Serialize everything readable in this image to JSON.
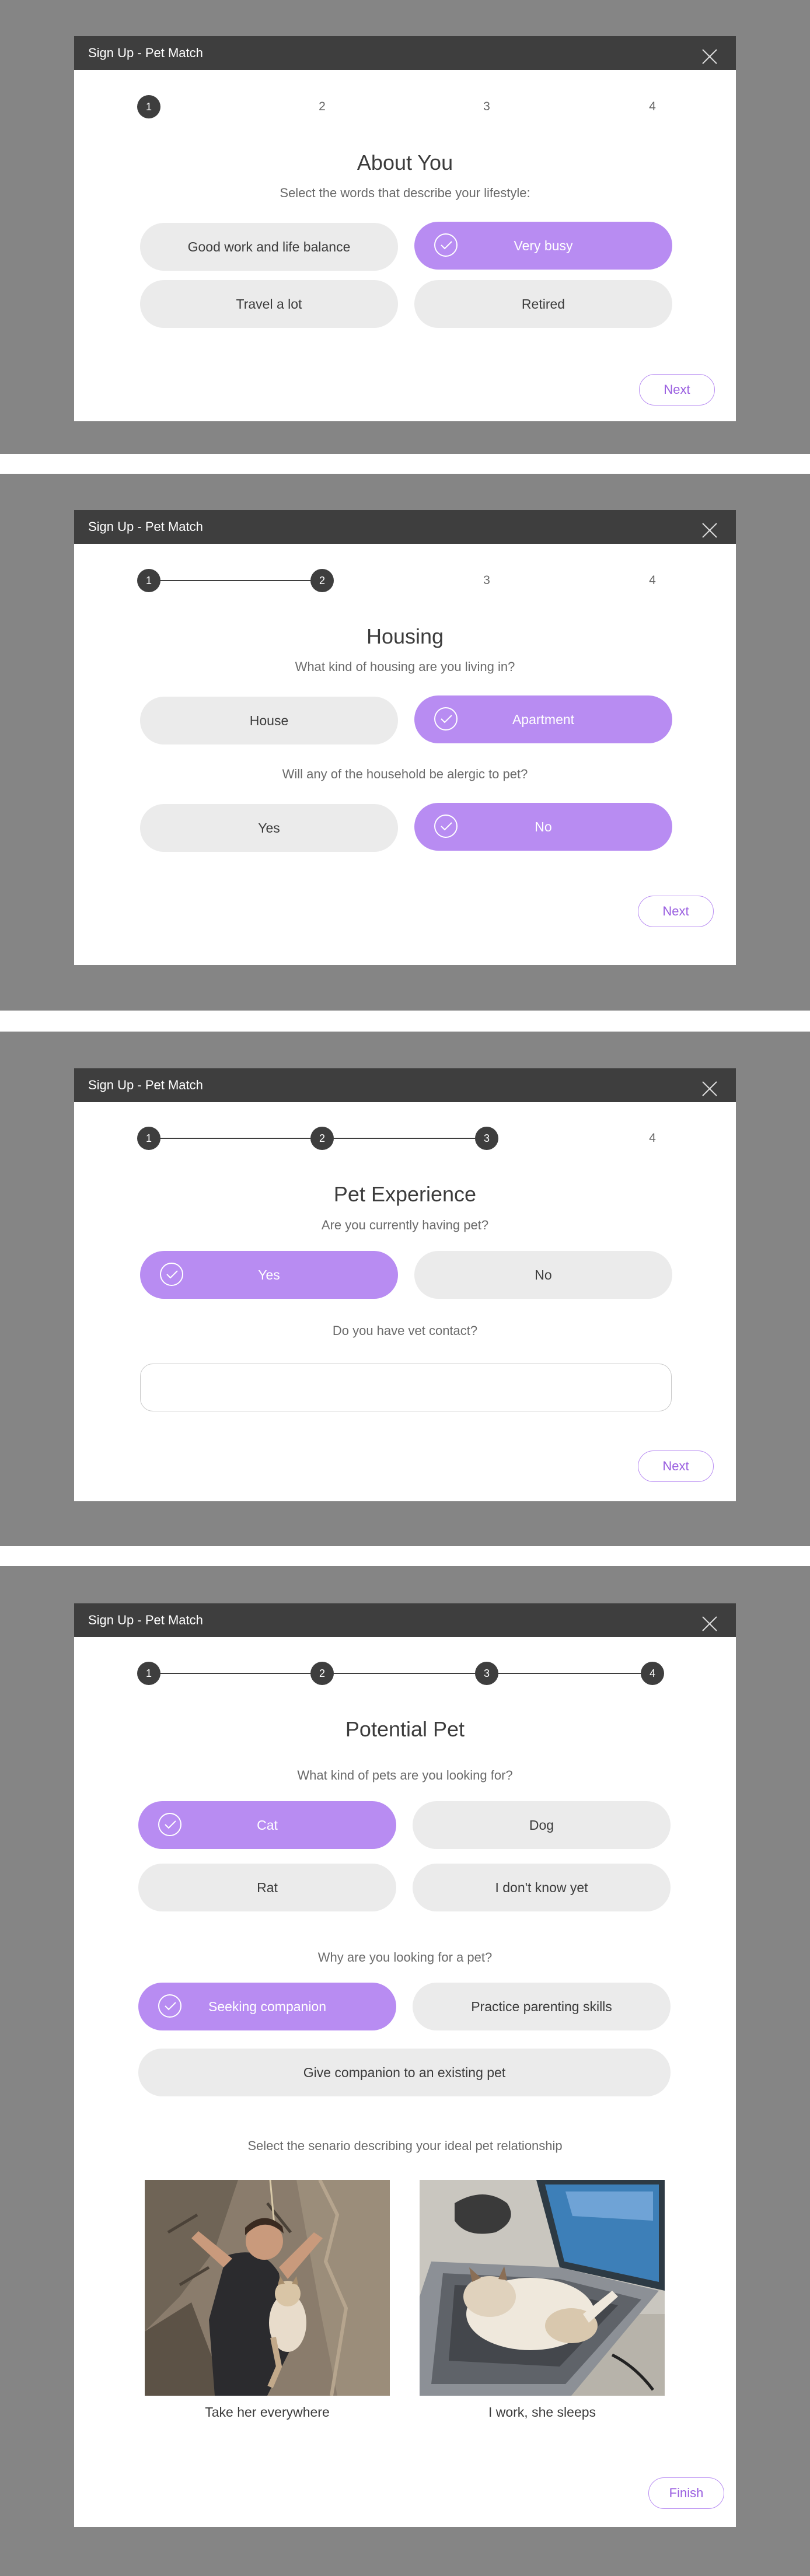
{
  "app_title": "Sign Up - Pet Match",
  "steps": [
    "1",
    "2",
    "3",
    "4"
  ],
  "next_label": "Next",
  "finish_label": "Finish",
  "accent_color": "#b88cf2",
  "header_color": "#3e3e3e",
  "screen1": {
    "title": "About You",
    "question": "Select the words that describe your lifestyle:",
    "options": [
      {
        "label": "Good work and life balance",
        "selected": false
      },
      {
        "label": "Very busy",
        "selected": true
      },
      {
        "label": "Travel a lot",
        "selected": false
      },
      {
        "label": "Retired",
        "selected": false
      }
    ]
  },
  "screen2": {
    "title": "Housing",
    "question1": "What kind of housing are you living in?",
    "options1": [
      {
        "label": "House",
        "selected": false
      },
      {
        "label": "Apartment",
        "selected": true
      }
    ],
    "question2": "Will any of the household be alergic to pet?",
    "options2": [
      {
        "label": "Yes",
        "selected": false
      },
      {
        "label": "No",
        "selected": true
      }
    ]
  },
  "screen3": {
    "title": "Pet Experience",
    "question1": "Are you currently having pet?",
    "options1": [
      {
        "label": "Yes",
        "selected": true
      },
      {
        "label": "No",
        "selected": false
      }
    ],
    "question2": "Do you have vet contact?",
    "vet_value": ""
  },
  "screen4": {
    "title": "Potential Pet",
    "question1": "What kind of pets are you looking for?",
    "options1": [
      {
        "label": "Cat",
        "selected": true
      },
      {
        "label": "Dog",
        "selected": false
      },
      {
        "label": "Rat",
        "selected": false
      },
      {
        "label": "I don't know yet",
        "selected": false
      }
    ],
    "question2": "Why are you looking for a pet?",
    "options2": [
      {
        "label": "Seeking companion",
        "selected": true
      },
      {
        "label": "Practice parenting skills",
        "selected": false
      },
      {
        "label": "Give companion to an existing pet",
        "selected": false
      }
    ],
    "question3": "Select the senario describing your ideal pet relationship",
    "scenarios": [
      {
        "caption": "Take her everywhere",
        "image": "climber-with-cat-photo"
      },
      {
        "caption": "I work, she sleeps",
        "image": "cat-sleeping-on-laptop-photo"
      }
    ]
  }
}
